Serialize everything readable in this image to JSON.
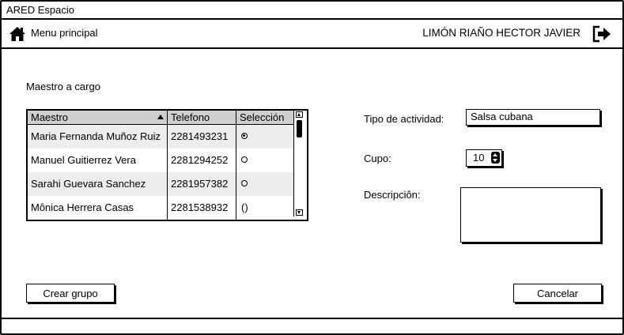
{
  "window": {
    "title": "ARED Espacio"
  },
  "nav": {
    "home_label": "Menu principal",
    "user_name": "LIMÓN RIAÑO HECTOR JAVIER"
  },
  "teacher_section": {
    "label": "Maestro a cargo"
  },
  "table": {
    "columns": [
      "Maestro",
      "Telefono",
      "Selección"
    ],
    "sort_column": "Maestro",
    "sort_direction": "ascending",
    "rows": [
      {
        "maestro": "Maria Fernanda Muñoz Ruiz",
        "telefono": "2281493231",
        "seleccion": "selected"
      },
      {
        "maestro": "Manuel Guitierrez Vera",
        "telefono": "2281294252",
        "seleccion": "unselected"
      },
      {
        "maestro": "Sarahi Guevara Sanchez",
        "telefono": "2281957382",
        "seleccion": "unselected"
      },
      {
        "maestro": "Mônica Herrera Casas",
        "telefono": "2281538932",
        "seleccion_text": "()"
      }
    ]
  },
  "form": {
    "tipo_label": "Tipo de actividad:",
    "tipo_value": "Salsa cubana",
    "cupo_label": "Cupo:",
    "cupo_value": "10",
    "descripcion_label": "Descripciôn:",
    "descripcion_value": ""
  },
  "buttons": {
    "create": "Crear grupo",
    "cancel": "Cancelar"
  },
  "icons": {
    "home": "home-icon",
    "logout": "logout-icon",
    "sort": "sort-ascending-icon"
  }
}
